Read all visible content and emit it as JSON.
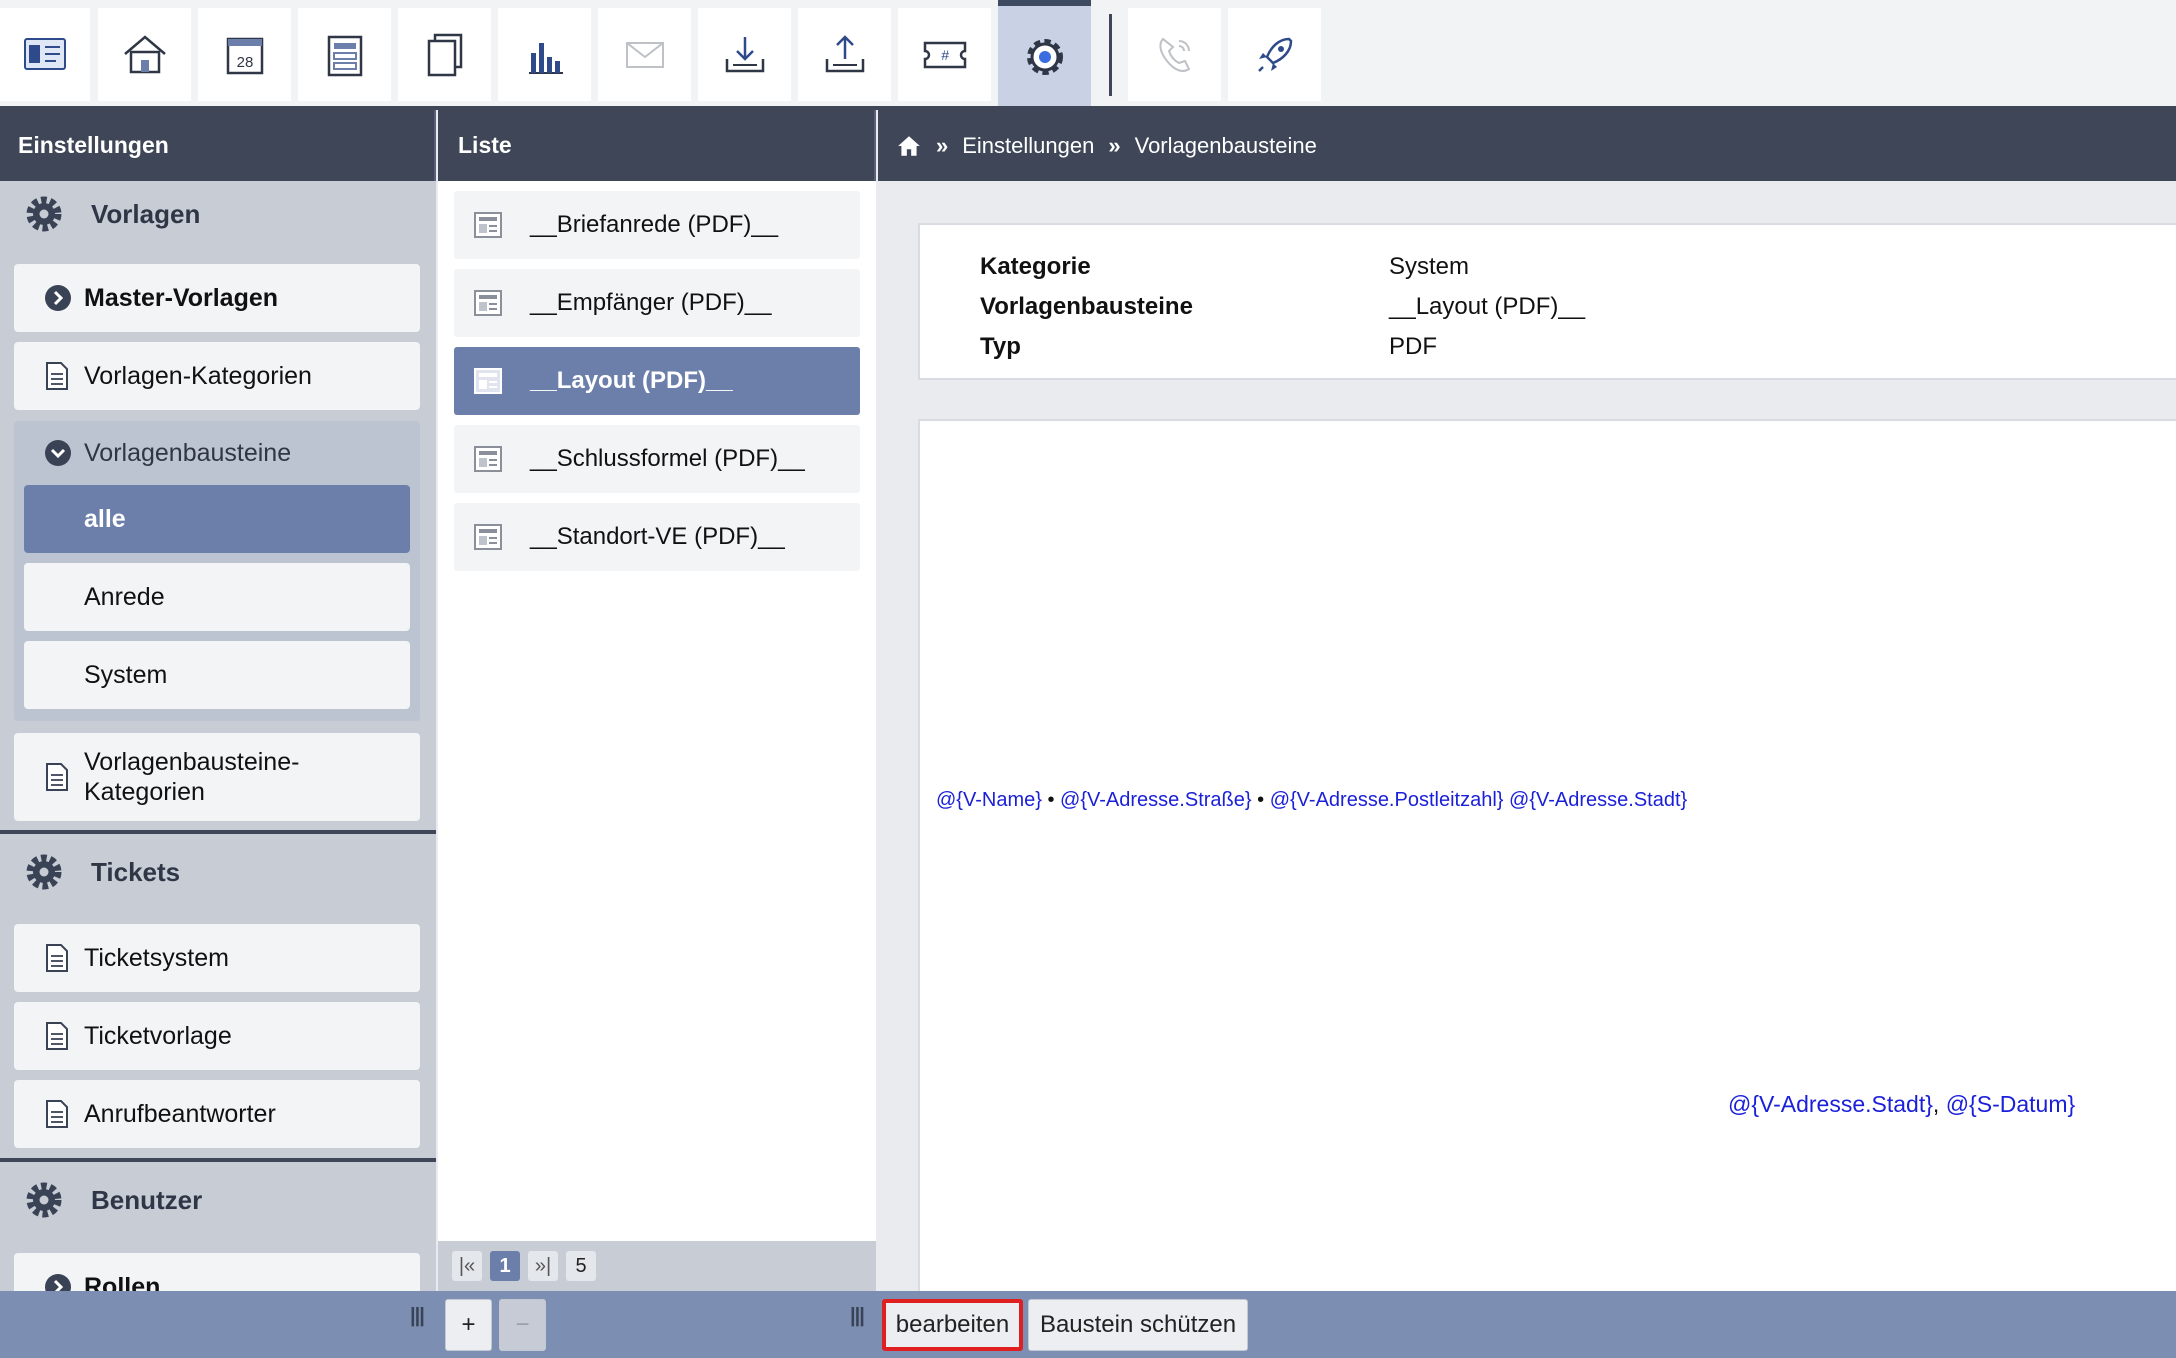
{
  "toolbar": {
    "buttons": [
      {
        "name": "contacts-icon"
      },
      {
        "name": "home-icon"
      },
      {
        "name": "calendar-icon",
        "label": "28"
      },
      {
        "name": "forms-icon"
      },
      {
        "name": "documents-icon"
      },
      {
        "name": "statistics-icon"
      },
      {
        "name": "mail-icon"
      },
      {
        "name": "download-icon"
      },
      {
        "name": "upload-icon"
      },
      {
        "name": "ticket-icon",
        "label": "#"
      },
      {
        "name": "settings-icon",
        "active": true
      },
      {
        "name": "phone-icon"
      },
      {
        "name": "rocket-icon"
      }
    ]
  },
  "headers": {
    "settings": "Einstellungen",
    "list": "Liste",
    "breadcrumb": {
      "home": "home-icon",
      "sep": "»",
      "items": [
        "Einstellungen",
        "Vorlagenbausteine"
      ]
    }
  },
  "sidebar": {
    "sections": [
      {
        "title": "Vorlagen",
        "icon": "gear-icon"
      },
      {
        "title": "Tickets",
        "icon": "gear-icon"
      },
      {
        "title": "Benutzer",
        "icon": "gear-icon"
      }
    ],
    "vorlagen": {
      "master": "Master-Vorlagen",
      "kategorien": "Vorlagen-Kategorien",
      "bausteine": "Vorlagenbausteine",
      "bausteine_sub": [
        "alle",
        "Anrede",
        "System"
      ],
      "bausteine_kat_1": "Vorlagenbausteine-",
      "bausteine_kat_2": "Kategorien"
    },
    "tickets": {
      "items": [
        "Ticketsystem",
        "Ticketvorlage",
        "Anrufbeantworter"
      ]
    },
    "benutzer": {
      "items": [
        "Rollen"
      ]
    }
  },
  "list": {
    "items": [
      "__Briefanrede (PDF)__",
      "__Empfänger (PDF)__",
      "__Layout (PDF)__",
      "__Schlussformel (PDF)__",
      "__Standort-VE (PDF)__"
    ],
    "active_index": 2,
    "pager": {
      "first": "|«",
      "current": "1",
      "last": "»|",
      "total": "5"
    }
  },
  "detail": {
    "info": [
      {
        "key": "Kategorie",
        "value": "System"
      },
      {
        "key": "Vorlagenbausteine",
        "value": "__Layout (PDF)__"
      },
      {
        "key": "Typ",
        "value": "PDF"
      }
    ],
    "preview": {
      "addr": {
        "name": "@{V-Name}",
        "bullet": " • ",
        "street": "@{V-Adresse.Straße}",
        "plz": "@{V-Adresse.Postleitzahl}",
        "city": "@{V-Adresse.Stadt}"
      },
      "date_line": {
        "city": "@{V-Adresse.Stadt}",
        "comma": ", ",
        "date": "@{S-Datum}"
      }
    }
  },
  "bottombar": {
    "add": "+",
    "remove": "−",
    "edit": "bearbeiten",
    "protect": "Baustein schützen",
    "grip": "|||"
  },
  "colors": {
    "accent": "#6b7faa",
    "header_bg": "#3e4657",
    "bottom_bar": "#7c8eb2",
    "placeholder_text": "#1a1fd9",
    "highlight_border": "#e02020"
  }
}
